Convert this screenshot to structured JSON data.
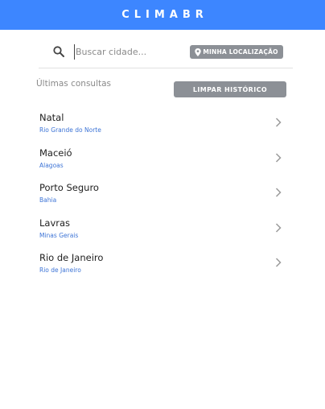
{
  "app": {
    "title": "CLIMABR"
  },
  "search": {
    "placeholder": "Buscar cidade...",
    "value": "",
    "location_button_label": "MINHA LOCALIZAÇÃO"
  },
  "history": {
    "label": "Últimas consultas",
    "clear_button_label": "LIMPAR HISTÓRICO",
    "items": [
      {
        "city": "Natal",
        "state": "Rio Grande do Norte"
      },
      {
        "city": "Maceió",
        "state": "Alagoas"
      },
      {
        "city": "Porto Seguro",
        "state": "Bahia"
      },
      {
        "city": "Lavras",
        "state": "Minas Gerais"
      },
      {
        "city": "Rio de Janeiro",
        "state": "Rio de Janeiro"
      }
    ]
  },
  "colors": {
    "header": "#3d86ff",
    "button": "#8c9096",
    "state_text": "#3d74d6"
  },
  "icons": {
    "search": "search-icon",
    "location": "map-pin-icon",
    "row_arrow": "chevron-right-icon"
  }
}
